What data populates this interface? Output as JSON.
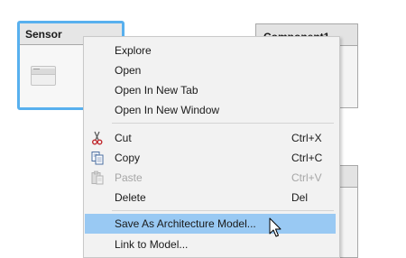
{
  "canvas": {
    "blocks": [
      {
        "name": "Sensor",
        "selected": true
      },
      {
        "name": "Component1",
        "selected": false
      },
      {
        "name": "",
        "selected": false
      }
    ]
  },
  "context_menu": {
    "items": [
      {
        "label": "Explore",
        "shortcut": "",
        "icon": "",
        "enabled": true
      },
      {
        "label": "Open",
        "shortcut": "",
        "icon": "",
        "enabled": true
      },
      {
        "label": "Open In New Tab",
        "shortcut": "",
        "icon": "",
        "enabled": true
      },
      {
        "label": "Open In New Window",
        "shortcut": "",
        "icon": "",
        "enabled": true
      },
      {
        "label": "Cut",
        "shortcut": "Ctrl+X",
        "icon": "scissors-icon",
        "enabled": true
      },
      {
        "label": "Copy",
        "shortcut": "Ctrl+C",
        "icon": "copy-icon",
        "enabled": true
      },
      {
        "label": "Paste",
        "shortcut": "Ctrl+V",
        "icon": "paste-icon",
        "enabled": false
      },
      {
        "label": "Delete",
        "shortcut": "Del",
        "icon": "",
        "enabled": true
      },
      {
        "label": "Save As Architecture Model...",
        "shortcut": "",
        "icon": "",
        "enabled": true,
        "highlighted": true
      },
      {
        "label": "Link to Model...",
        "shortcut": "",
        "icon": "",
        "enabled": true
      }
    ]
  },
  "colors": {
    "selection_border": "#58b0ee",
    "menu_highlight": "#99c9f3",
    "menu_background": "#f2f2f2",
    "disabled_text": "#a6a6a6"
  }
}
